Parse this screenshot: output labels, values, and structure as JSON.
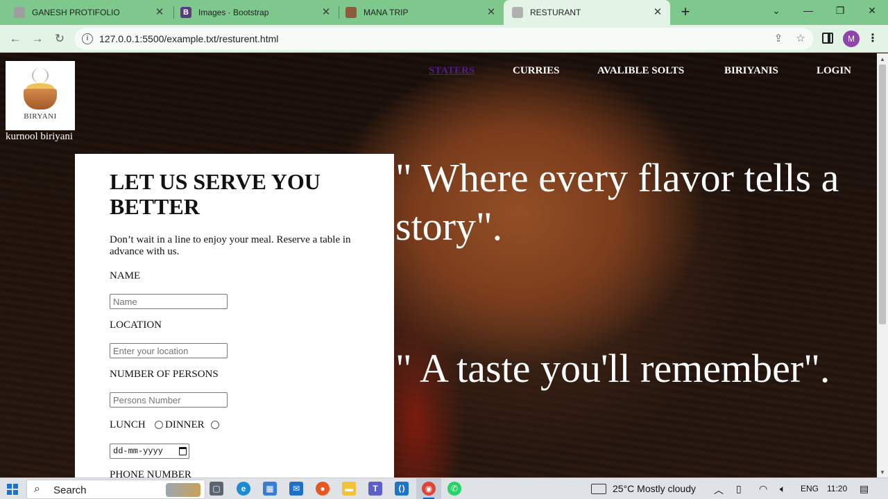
{
  "browser": {
    "tabs": [
      {
        "title": "GANESH PROTIFOLIO",
        "favicon": "#9e9e9e"
      },
      {
        "title": "Images · Bootstrap",
        "favicon": "#563d7c"
      },
      {
        "title": "MANA TRIP",
        "favicon": "#8d5a3c"
      },
      {
        "title": "RESTURANT",
        "favicon": "#b0b0b0"
      }
    ],
    "new_tab": "+",
    "url": "127.0.0.1:5500/example.txt/resturent.html",
    "profile_initial": "M"
  },
  "site": {
    "logo_text": "BIRYANI",
    "brand_name": "kurnool biriyani",
    "nav": [
      "STATERS",
      "CURRIES",
      "AVALIBLE SOLTS",
      "BIRIYANIS",
      "LOGIN"
    ]
  },
  "form": {
    "title": "LET US SERVE YOU BETTER",
    "description": "Don’t wait in a line to enjoy your meal. Reserve a table in advance with us.",
    "name_label": "NAME",
    "name_placeholder": "Name",
    "location_label": "LOCATION",
    "location_placeholder": "Enter your location",
    "persons_label": "NUMBER OF PERSONS",
    "persons_placeholder": "Persons Number",
    "lunch_label": "LUNCH",
    "dinner_label": "DINNER",
    "date_placeholder": "dd-mm-yyyy",
    "phone_label": "PHONE NUMBER"
  },
  "quotes": {
    "first_line1": "\" Where every flavor tells a",
    "first_line2": "story\".",
    "second": "\" A taste you'll remember\"."
  },
  "taskbar": {
    "search": "Search",
    "weather": "25°C  Mostly cloudy",
    "lang": "ENG",
    "time": "11:20"
  },
  "colors": {
    "tabbar": "#7fc88d",
    "toolbar": "#e3f4e6",
    "visited_link": "#551a8b"
  }
}
